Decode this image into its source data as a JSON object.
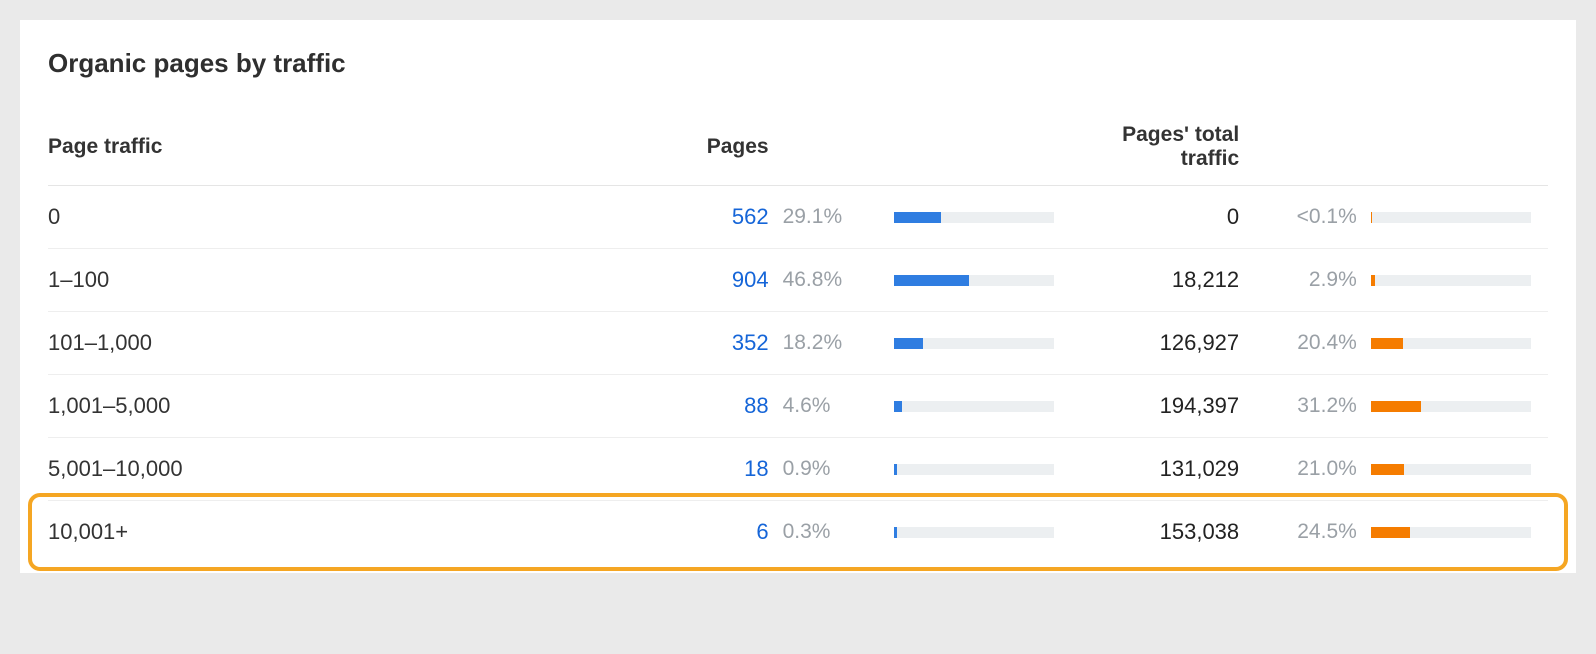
{
  "title": "Organic pages by traffic",
  "headers": {
    "range": "Page traffic",
    "pages": "Pages",
    "traffic": "Pages' total traffic"
  },
  "rows": [
    {
      "range": "0",
      "pages": "562",
      "pages_pct": "29.1%",
      "pages_bar_w": 29.1,
      "traffic": "0",
      "traffic_pct": "<0.1%",
      "traffic_bar_w": 0.5
    },
    {
      "range": "1–100",
      "pages": "904",
      "pages_pct": "46.8%",
      "pages_bar_w": 46.8,
      "traffic": "18,212",
      "traffic_pct": "2.9%",
      "traffic_bar_w": 2.9
    },
    {
      "range": "101–1,000",
      "pages": "352",
      "pages_pct": "18.2%",
      "pages_bar_w": 18.2,
      "traffic": "126,927",
      "traffic_pct": "20.4%",
      "traffic_bar_w": 20.4
    },
    {
      "range": "1,001–5,000",
      "pages": "88",
      "pages_pct": "4.6%",
      "pages_bar_w": 4.6,
      "traffic": "194,397",
      "traffic_pct": "31.2%",
      "traffic_bar_w": 31.2
    },
    {
      "range": "5,001–10,000",
      "pages": "18",
      "pages_pct": "0.9%",
      "pages_bar_w": 2,
      "traffic": "131,029",
      "traffic_pct": "21.0%",
      "traffic_bar_w": 21.0
    },
    {
      "range": "10,001+",
      "pages": "6",
      "pages_pct": "0.3%",
      "pages_bar_w": 2,
      "traffic": "153,038",
      "traffic_pct": "24.5%",
      "traffic_bar_w": 24.5
    }
  ],
  "highlight_row_index": 5,
  "colors": {
    "pages_bar": "#2f7de1",
    "traffic_bar": "#f57c00",
    "highlight_border": "#f5a623"
  },
  "chart_data": {
    "type": "table",
    "title": "Organic pages by traffic",
    "categories": [
      "0",
      "1–100",
      "101–1,000",
      "1,001–5,000",
      "5,001–10,000",
      "10,001+"
    ],
    "series": [
      {
        "name": "Pages",
        "values": [
          562,
          904,
          352,
          88,
          18,
          6
        ]
      },
      {
        "name": "Pages %",
        "values": [
          29.1,
          46.8,
          18.2,
          4.6,
          0.9,
          0.3
        ]
      },
      {
        "name": "Pages' total traffic",
        "values": [
          0,
          18212,
          126927,
          194397,
          131029,
          153038
        ]
      },
      {
        "name": "Traffic %",
        "values": [
          0.05,
          2.9,
          20.4,
          31.2,
          21.0,
          24.5
        ]
      }
    ]
  }
}
